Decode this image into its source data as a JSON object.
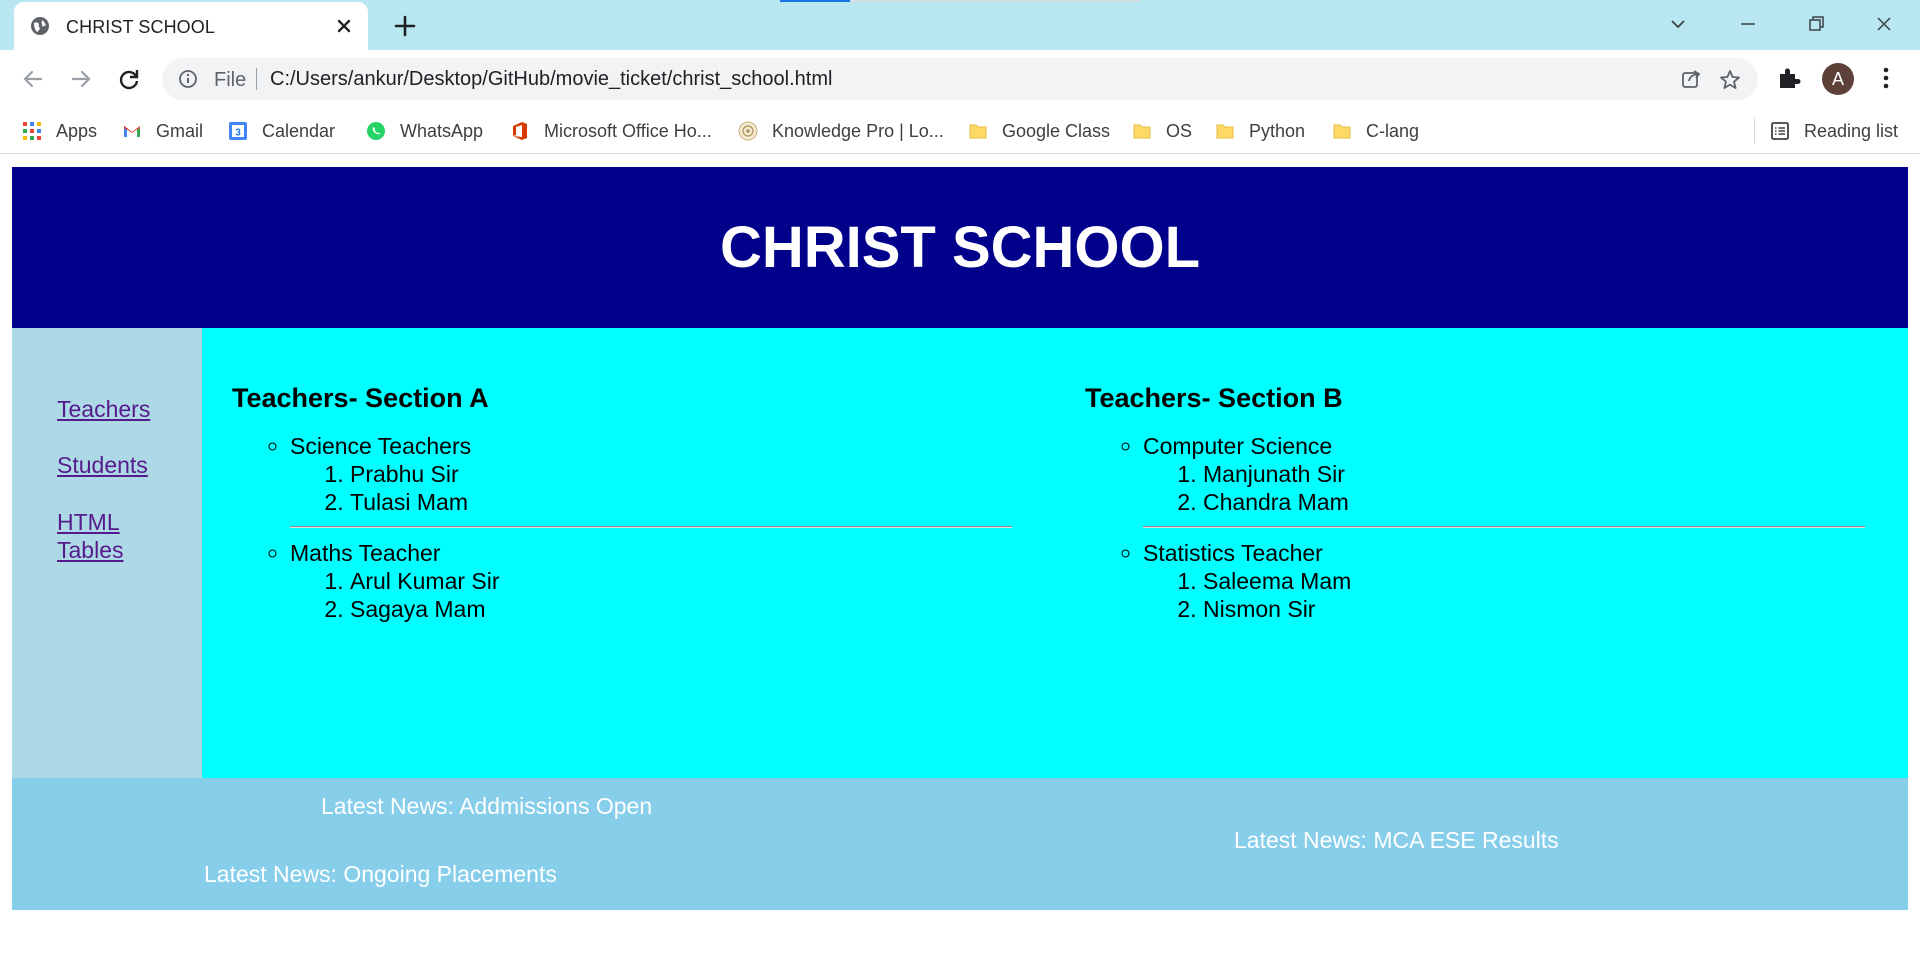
{
  "browser": {
    "tab_title": "CHRIST SCHOOL",
    "url_scheme": "File",
    "url": "C:/Users/ankur/Desktop/GitHub/movie_ticket/christ_school.html",
    "profile_initial": "A"
  },
  "bookmarks": {
    "items": [
      {
        "label": "Apps",
        "icon": "apps-grid-icon"
      },
      {
        "label": "Gmail",
        "icon": "gmail-icon"
      },
      {
        "label": "Calendar",
        "icon": "calendar-icon"
      },
      {
        "label": "WhatsApp",
        "icon": "whatsapp-icon"
      },
      {
        "label": "Microsoft Office Ho...",
        "icon": "office-icon"
      },
      {
        "label": "Knowledge Pro | Lo...",
        "icon": "knowledge-pro-icon"
      },
      {
        "label": "Google Class",
        "icon": "folder-icon"
      },
      {
        "label": "OS",
        "icon": "folder-icon"
      },
      {
        "label": "Python",
        "icon": "folder-icon"
      },
      {
        "label": "C-lang",
        "icon": "folder-icon"
      }
    ],
    "reading_list": "Reading list"
  },
  "page": {
    "header_title": "CHRIST SCHOOL",
    "sidebar_links": [
      "Teachers",
      "Students",
      "HTML Tables"
    ],
    "section_a": {
      "title": "Teachers- Section A",
      "groups": [
        {
          "name": "Science Teachers",
          "members": [
            "Prabhu Sir",
            "Tulasi Mam"
          ]
        },
        {
          "name": "Maths Teacher",
          "members": [
            "Arul Kumar Sir",
            "Sagaya Mam"
          ]
        }
      ]
    },
    "section_b": {
      "title": "Teachers- Section B",
      "groups": [
        {
          "name": "Computer Science",
          "members": [
            "Manjunath Sir",
            "Chandra Mam"
          ]
        },
        {
          "name": "Statistics Teacher",
          "members": [
            "Saleema Mam",
            "Nismon Sir"
          ]
        }
      ]
    },
    "news": [
      "Latest News: Addmissions Open",
      "Latest News: Ongoing Placements",
      "Latest News: MCA ESE Results"
    ]
  },
  "colors": {
    "header_bg": "#00008b",
    "sidebar_bg": "#add8e6",
    "main_bg": "#00ffff",
    "footer_bg": "#87ceeb",
    "titlebar_bg": "#b8e7f2"
  }
}
